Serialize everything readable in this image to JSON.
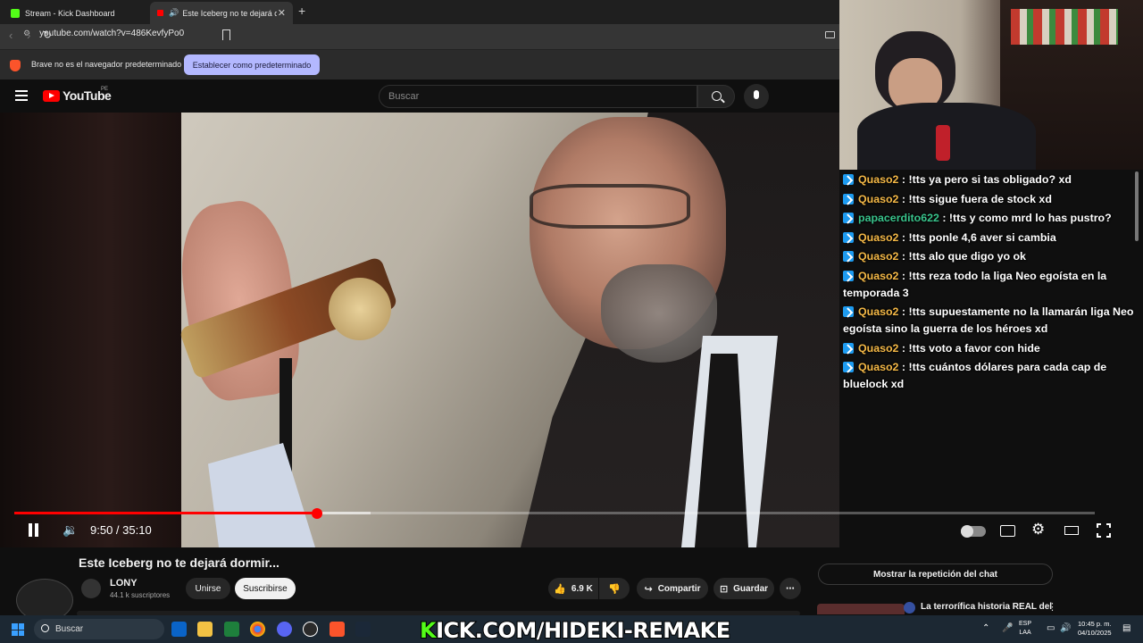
{
  "browser": {
    "tabs": [
      {
        "label": "Stream - Kick Dashboard",
        "active": false
      },
      {
        "label": "Este Iceberg no te dejará dormir...",
        "active": true
      }
    ],
    "url": "youtube.com/watch?v=486KevfyPo0",
    "banner_text": "Brave no es el navegador predeterminado",
    "banner_button": "Establecer como predeterminado"
  },
  "youtube": {
    "logo": "YouTube",
    "country": "PE",
    "search_placeholder": "Buscar"
  },
  "player": {
    "time": "9:50 / 35:10",
    "progress": 0.28,
    "buffered": 0.33
  },
  "chat": [
    {
      "user": "Quaso2",
      "text": ": !tts ya pero si tas obligado? xd",
      "alt": false
    },
    {
      "user": "Quaso2",
      "text": ": !tts sigue fuera de stock xd",
      "alt": false
    },
    {
      "user": "papacerdito622",
      "text": ": !tts y como mrd lo has pustro?",
      "alt": true
    },
    {
      "user": "Quaso2",
      "text": ": !tts ponle 4,6 aver si cambia",
      "alt": false
    },
    {
      "user": "Quaso2",
      "text": ": !tts alo que digo yo ok",
      "alt": false
    },
    {
      "user": "Quaso2",
      "text": ": !tts reza todo la liga Neo egoísta en la temporada 3",
      "alt": false
    },
    {
      "user": "Quaso2",
      "text": ": !tts supuestamente no la llamarán liga Neo egoísta sino la guerra de los héroes xd",
      "alt": false
    },
    {
      "user": "Quaso2",
      "text": ": !tts voto a favor con hide",
      "alt": false
    },
    {
      "user": "Quaso2",
      "text": ": !tts cuántos dólares para cada cap de bluelock xd",
      "alt": false
    }
  ],
  "video": {
    "title": "Este Iceberg no te dejará dormir...",
    "channel": "LONY",
    "subscribers": "44.1 k suscriptores",
    "join_label": "Unirse",
    "subscribe_label": "Suscribirse",
    "likes": "6.9 K",
    "share_label": "Compartir",
    "save_label": "Guardar",
    "chat_replay_label": "Mostrar la repetición del chat",
    "recommended_title": "La terrorífica historia REAL del"
  },
  "taskbar": {
    "search_placeholder": "Buscar",
    "kick_url": "KICK.COM/HIDEKI-REMAKE",
    "lang_line1": "ESP",
    "lang_line2": "LAA",
    "time": "10:45 p. m.",
    "date": "04/10/2025"
  },
  "colors": {
    "accent": "#ff0000",
    "kick_green": "#53fc18",
    "chat_user": "#f5b947",
    "chat_user_alt": "#39c48c"
  }
}
